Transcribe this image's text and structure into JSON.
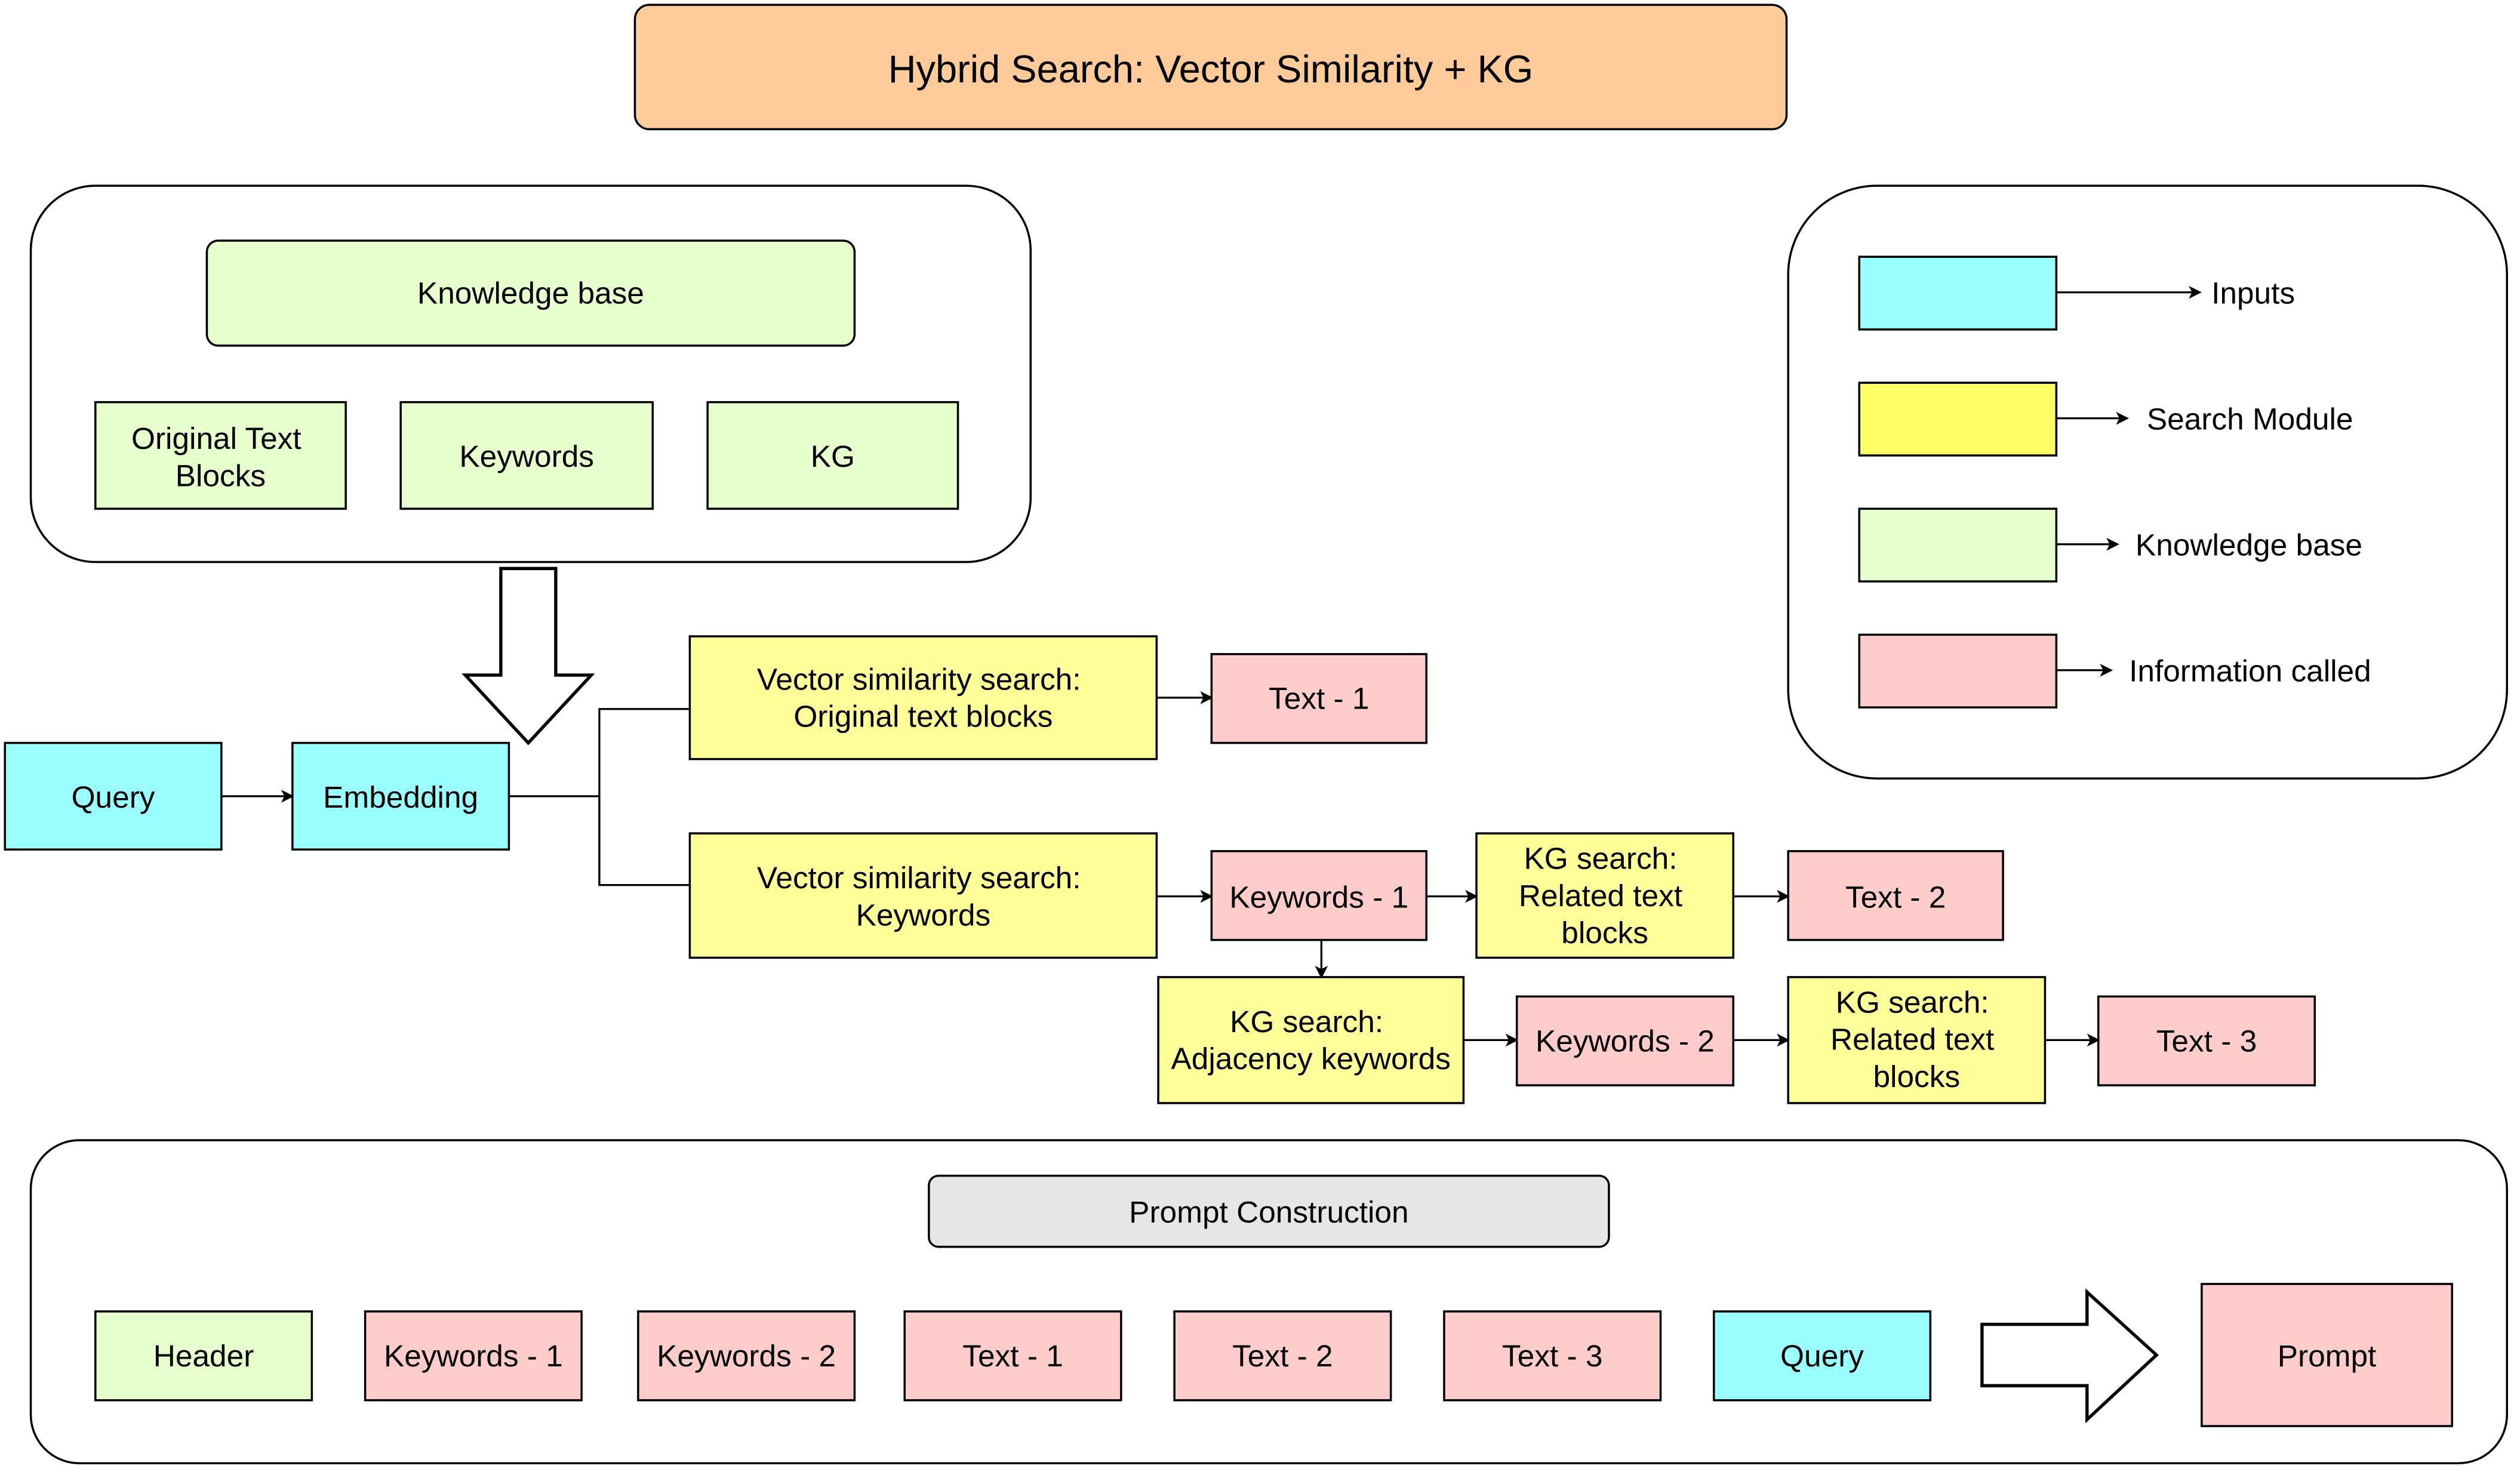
{
  "title": "Hybrid Search: Vector Similarity + KG",
  "colors": {
    "title": "#FFCC99",
    "inputs": "#99FFFF",
    "search_module": "#FFFF99",
    "knowledge_base": "#E6FFCC",
    "information_called": "#FFCCCC",
    "prompt_construction": "#E6E6E6",
    "legend_search_swatch": "#FFFF66"
  },
  "knowledge_base_group": {
    "header": "Knowledge base",
    "items": [
      "Original Text Blocks",
      "Keywords",
      "KG"
    ]
  },
  "legend": {
    "items": [
      {
        "label": "Inputs"
      },
      {
        "label": "Search Module"
      },
      {
        "label": "Knowledge base"
      },
      {
        "label": "Information called"
      }
    ]
  },
  "flow": {
    "query": "Query",
    "embedding": "Embedding",
    "vs_original_1": "Vector similarity search:",
    "vs_original_2": "Original text blocks",
    "text1": "Text - 1",
    "vs_keywords_1": "Vector similarity search:",
    "vs_keywords_2": "Keywords",
    "keywords1": "Keywords - 1",
    "kg_related_a_1": "KG search:",
    "kg_related_a_2": "Related text",
    "kg_related_a_3": "blocks",
    "text2": "Text - 2",
    "kg_adjacency_1": "KG search:",
    "kg_adjacency_2": "Adjacency keywords",
    "keywords2": "Keywords - 2",
    "kg_related_b_1": "KG search:",
    "kg_related_b_2": "Related text",
    "kg_related_b_3": "blocks",
    "text3": "Text - 3"
  },
  "prompt_construction": {
    "header": "Prompt Construction",
    "items": [
      "Header",
      "Keywords - 1",
      "Keywords - 2",
      "Text - 1",
      "Text - 2",
      "Text - 3",
      "Query"
    ],
    "output": "Prompt"
  }
}
